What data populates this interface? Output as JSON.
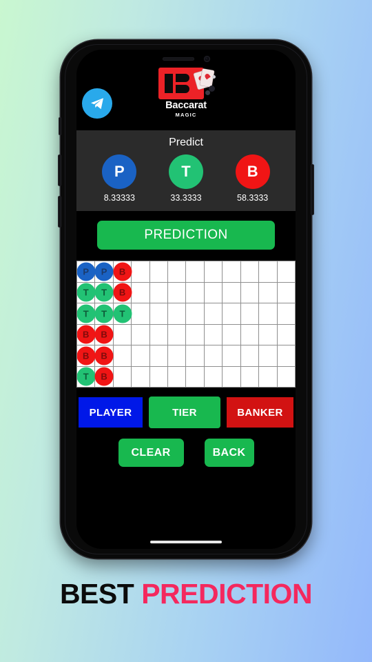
{
  "caption": {
    "word1": "BEST",
    "word2": "PREDICTION"
  },
  "app": {
    "header": {
      "telegram_icon": "telegram-icon",
      "brand_name": "Baccarat",
      "brand_sub": "MAGIC"
    },
    "predict": {
      "title": "Predict",
      "items": [
        {
          "key": "P",
          "label": "P",
          "value": "8.33333",
          "color": "#1a62c4",
          "name": "player"
        },
        {
          "key": "T",
          "label": "T",
          "value": "33.3333",
          "color": "#22c274",
          "name": "tier"
        },
        {
          "key": "B",
          "label": "B",
          "value": "58.3333",
          "color": "#f01515",
          "name": "banker"
        }
      ]
    },
    "prediction_button": {
      "label": "PREDICTION",
      "color": "#18b84f"
    },
    "road": {
      "columns": 12,
      "rows": 6,
      "beads": [
        [
          "P",
          "P",
          "B",
          "",
          "",
          "",
          "",
          "",
          "",
          "",
          "",
          ""
        ],
        [
          "T",
          "T",
          "B",
          "",
          "",
          "",
          "",
          "",
          "",
          "",
          "",
          ""
        ],
        [
          "T",
          "T",
          "T",
          "",
          "",
          "",
          "",
          "",
          "",
          "",
          "",
          ""
        ],
        [
          "B",
          "B",
          "",
          "",
          "",
          "",
          "",
          "",
          "",
          "",
          "",
          ""
        ],
        [
          "B",
          "B",
          "",
          "",
          "",
          "",
          "",
          "",
          "",
          "",
          "",
          ""
        ],
        [
          "T",
          "B",
          "",
          "",
          "",
          "",
          "",
          "",
          "",
          "",
          "",
          ""
        ]
      ]
    },
    "actions": {
      "player": {
        "label": "PLAYER",
        "color": "#0018e8"
      },
      "tier": {
        "label": "TIER",
        "color": "#18b84f"
      },
      "banker": {
        "label": "BANKER",
        "color": "#d21212"
      },
      "clear": {
        "label": "CLEAR",
        "color": "#18b84f"
      },
      "back": {
        "label": "BACK",
        "color": "#18b84f"
      }
    }
  }
}
